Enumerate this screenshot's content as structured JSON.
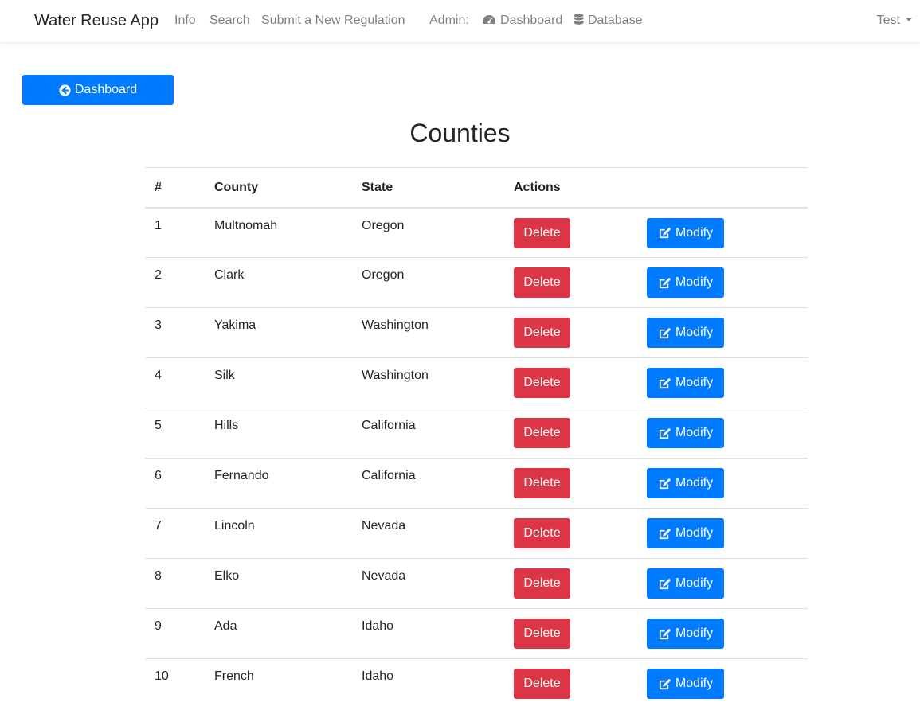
{
  "navbar": {
    "brand": "Water Reuse App",
    "links": [
      "Info",
      "Search",
      "Submit a New Regulation"
    ],
    "admin_label": "Admin:",
    "admin_links": [
      {
        "label": "Dashboard",
        "icon": "dashboard-gauge-icon"
      },
      {
        "label": "Database",
        "icon": "database-icon"
      }
    ],
    "user": "Test"
  },
  "back_button": {
    "label": "Dashboard",
    "icon": "arrow-circle-left-icon"
  },
  "page_title": "Counties",
  "table": {
    "headers": [
      "#",
      "County",
      "State",
      "Actions"
    ],
    "delete_label": "Delete",
    "modify_label": "Modify",
    "rows": [
      {
        "num": "1",
        "county": "Multnomah",
        "state": "Oregon"
      },
      {
        "num": "2",
        "county": "Clark",
        "state": "Oregon"
      },
      {
        "num": "3",
        "county": "Yakima",
        "state": "Washington"
      },
      {
        "num": "4",
        "county": "Silk",
        "state": "Washington"
      },
      {
        "num": "5",
        "county": "Hills",
        "state": "California"
      },
      {
        "num": "6",
        "county": "Fernando",
        "state": "California"
      },
      {
        "num": "7",
        "county": "Lincoln",
        "state": "Nevada"
      },
      {
        "num": "8",
        "county": "Elko",
        "state": "Nevada"
      },
      {
        "num": "9",
        "county": "Ada",
        "state": "Idaho"
      },
      {
        "num": "10",
        "county": "French",
        "state": "Idaho"
      }
    ]
  },
  "colors": {
    "primary": "#007bff",
    "danger": "#dc3545",
    "nav_text": "#808080"
  }
}
